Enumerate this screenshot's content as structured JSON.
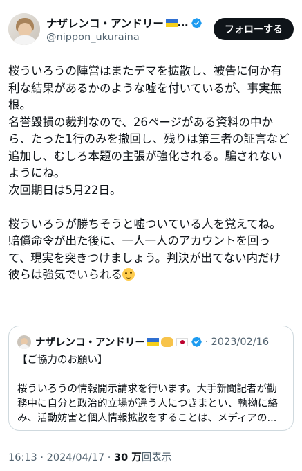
{
  "author": {
    "name": "ナザレンコ・アンドリー",
    "name_suffix": "…",
    "handle": "@nippon_ukuraina",
    "follow_label": "フォローする",
    "flag_icon": "ukraine-flag-icon",
    "verified_icon": "verified-badge-icon",
    "verified_color": "#1d9bf0"
  },
  "tweet": {
    "paragraph_1": "桜ういろうの陣営はまたデマを拡散し、被告に何か有\n利な結果があるかのような嘘を付いているが、事実無\n根。\n名誉毀損の裁判なので、26ページがある資料の中か\nら、たった1行のみを撤回し、残りは第三者の証言など\n追加し、むしろ本題の主張が強化される。騙されない\nようにね。\n次回期日は5月22日。",
    "paragraph_2": "桜ういろうが勝ちそうと嘘ついている人を覚えてね。\n賠償命令が出た後に、一人一人のアカウントを回っ\nて、現実を突きつけましょう。判決が出てない内だけ\n彼らは強気でいられる",
    "emoji_icon": "smirking-face-emoji"
  },
  "quote": {
    "name": "ナザレンコ・アンドリー",
    "separator": "·",
    "date": "2023/02/16",
    "title": "【ご協力のお願い】",
    "body": "桜ういろうの情報開示請求を行います。大手新聞記者が勤\n務中に自分と政治的立場が違う人につきまとい、執拗に絡\nみ、活動妨害と個人情報拡散をすることは、メディアの..."
  },
  "meta": {
    "time": "16:13",
    "separator": " · ",
    "date": "2024/04/17",
    "views_count": "30 万",
    "views_label": "回表示"
  }
}
